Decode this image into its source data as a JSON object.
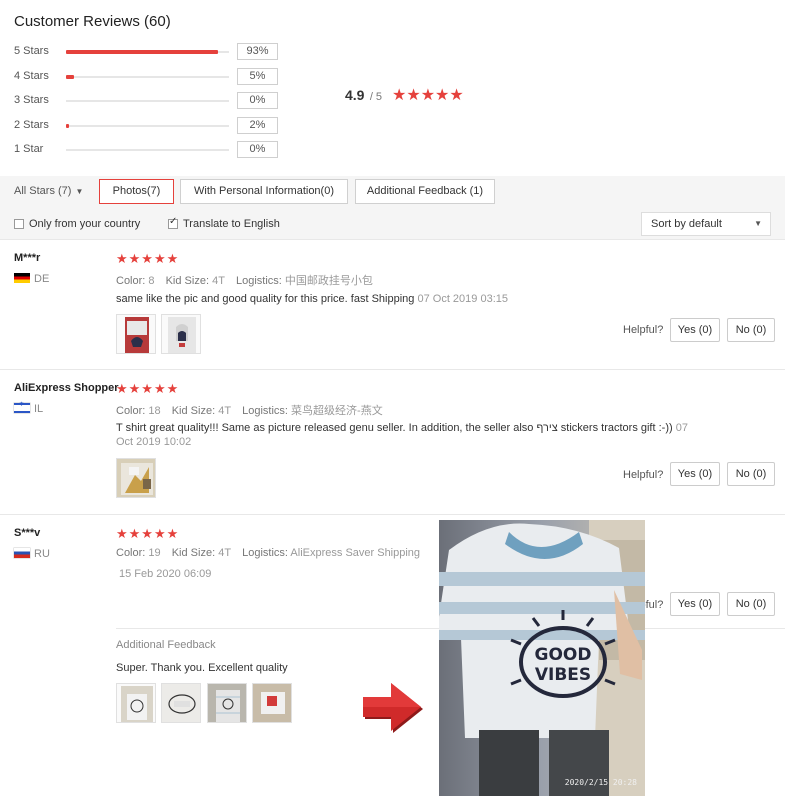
{
  "header": {
    "title": "Customer Reviews (60)"
  },
  "ratings": [
    {
      "label": "5 Stars",
      "percent_label": "93%",
      "fraction": 0.93
    },
    {
      "label": "4 Stars",
      "percent_label": "5%",
      "fraction": 0.05
    },
    {
      "label": "3 Stars",
      "percent_label": "0%",
      "fraction": 0.0
    },
    {
      "label": "2 Stars",
      "percent_label": "2%",
      "fraction": 0.02
    },
    {
      "label": "1 Star",
      "percent_label": "0%",
      "fraction": 0.0
    }
  ],
  "average": {
    "score": "4.9",
    "out_of": "/ 5",
    "stars": "★★★★★"
  },
  "filters": {
    "all_stars": "All Stars (7)",
    "photos": "Photos(7)",
    "personal_info": "With Personal Information(0)",
    "additional": "Additional Feedback (1)"
  },
  "options": {
    "only_country": "Only from your country",
    "only_country_checked": false,
    "translate": "Translate to English",
    "translate_checked": true,
    "sort": "Sort by default"
  },
  "reviews": [
    {
      "name": "M***r",
      "country": "DE",
      "stars": "★★★★★",
      "color_label": "Color:",
      "color": "8",
      "size_label": "Kid Size:",
      "size": "4T",
      "logistics_label": "Logistics:",
      "logistics": "中国邮政挂号小包",
      "text": "same like the pic and good quality for this price. fast Shipping",
      "date": "07 Oct 2019 03:15",
      "helpful": "Helpful?",
      "yes": "Yes (0)",
      "no": "No (0)"
    },
    {
      "name": "AliExpress Shopper",
      "country": "IL",
      "stars": "★★★★★",
      "color_label": "Color:",
      "color": "18",
      "size_label": "Kid Size:",
      "size": "4T",
      "logistics_label": "Logistics:",
      "logistics": "菜鸟超级经济-燕文",
      "text": "T shirt great quality!!! Same as picture released genu seller. In addition, the seller also צירף stickers tractors gift :-))",
      "date_part1": "07",
      "date_part2": "Oct 2019 10:02",
      "helpful": "Helpful?",
      "yes": "Yes (0)",
      "no": "No (0)"
    },
    {
      "name": "S***v",
      "country": "RU",
      "stars": "★★★★★",
      "color_label": "Color:",
      "color": "19",
      "size_label": "Kid Size:",
      "size": "4T",
      "logistics_label": "Logistics:",
      "logistics": "AliExpress Saver Shipping",
      "date": "15 Feb 2020 06:09",
      "helpful": "Helpful?",
      "yes": "Yes (0)",
      "no": "No (0)",
      "additional_title": "Additional Feedback",
      "additional_text": "Super. Thank you. Excellent quality"
    }
  ],
  "photo": {
    "shirt_text": "GOOD VIBES",
    "timestamp": "2020/2/15  20:28"
  },
  "colors": {
    "accent": "#e5413c",
    "filter_bg": "#f5f5f5"
  }
}
